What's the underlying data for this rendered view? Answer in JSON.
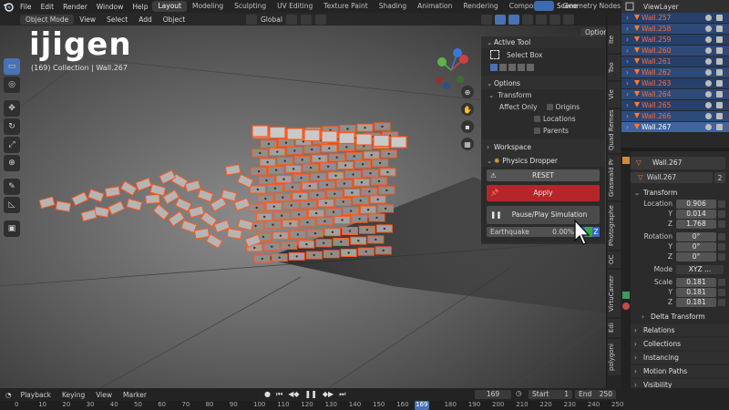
{
  "menubar": {
    "items": [
      "File",
      "Edit",
      "Render",
      "Window",
      "Help"
    ],
    "workspaces": [
      "Layout",
      "Modeling",
      "Sculpting",
      "UV Editing",
      "Texture Paint",
      "Shading",
      "Animation",
      "Rendering",
      "Compositing",
      "Geometry Nodes"
    ],
    "active_workspace": "Layout",
    "scene": "Scene",
    "view_layer": "ViewLayer"
  },
  "viewport": {
    "mode": "Object Mode",
    "menus": [
      "View",
      "Select",
      "Add",
      "Object"
    ],
    "orientation": "Global",
    "options": "Options",
    "overlay_logo": "ijigen",
    "collection_label": "(169) Collection | Wall.267"
  },
  "npanel": {
    "active_tool_title": "Active Tool",
    "active_tool_value": "Select Box",
    "options_title": "Options",
    "transform_title": "Transform",
    "affect_only": "Affect Only",
    "origins": "Origins",
    "locations": "Locations",
    "parents": "Parents",
    "workspace_title": "Workspace",
    "physics_dropper_title": "Physics Dropper",
    "reset": "RESET",
    "apply": "Apply",
    "pause_play": "Pause/Play Simulation",
    "earthquake_label": "Earthquake",
    "earthquake_value": "0.00%",
    "x": "X",
    "z": "Z"
  },
  "vtabs": [
    "Ite",
    "Too",
    "Vie",
    "Quad Remes",
    "Graswald Pr",
    "Photographe",
    "OC",
    "VirtuCamer",
    "Edi",
    "polygoni"
  ],
  "outliner": {
    "rows": [
      "Wall.257",
      "Wall.258",
      "Wall.259",
      "Wall.260",
      "Wall.261",
      "Wall.262",
      "Wall.263",
      "Wall.264",
      "Wall.265",
      "Wall.266",
      "Wall.267"
    ],
    "active_row": "Wall.267"
  },
  "properties": {
    "object_name": "Wall.267",
    "data_name": "Wall.267",
    "users": "2",
    "transform_title": "Transform",
    "location_label": "Location",
    "location": [
      "0.906",
      "0.014",
      "1.768"
    ],
    "rotation_label": "Rotation",
    "rotation": [
      "0°",
      "0°",
      "0°"
    ],
    "mode_label": "Mode",
    "mode_value": "XYZ ...",
    "scale_label": "Scale",
    "scale": [
      "0.181",
      "0.181",
      "0.181"
    ],
    "axes": [
      "X",
      "Y",
      "Z"
    ],
    "delta_transform": "Delta Transform",
    "sections": [
      "Relations",
      "Collections",
      "Instancing",
      "Motion Paths",
      "Visibility"
    ]
  },
  "timeline": {
    "menus": [
      "Playback",
      "Keying",
      "View",
      "Marker"
    ],
    "current_frame": "169",
    "start_label": "Start",
    "start_value": "1",
    "end_label": "End",
    "end_value": "250",
    "ruler_ticks": [
      "0",
      "10",
      "20",
      "30",
      "40",
      "50",
      "60",
      "70",
      "80",
      "90",
      "100",
      "110",
      "120",
      "130",
      "140",
      "150",
      "160",
      "169",
      "180",
      "190",
      "200",
      "210",
      "220",
      "230",
      "240",
      "250"
    ]
  },
  "colors": {
    "accent_blue": "#4772b3",
    "apply_red": "#b5262b",
    "selection_orange": "#ff5a1f"
  }
}
